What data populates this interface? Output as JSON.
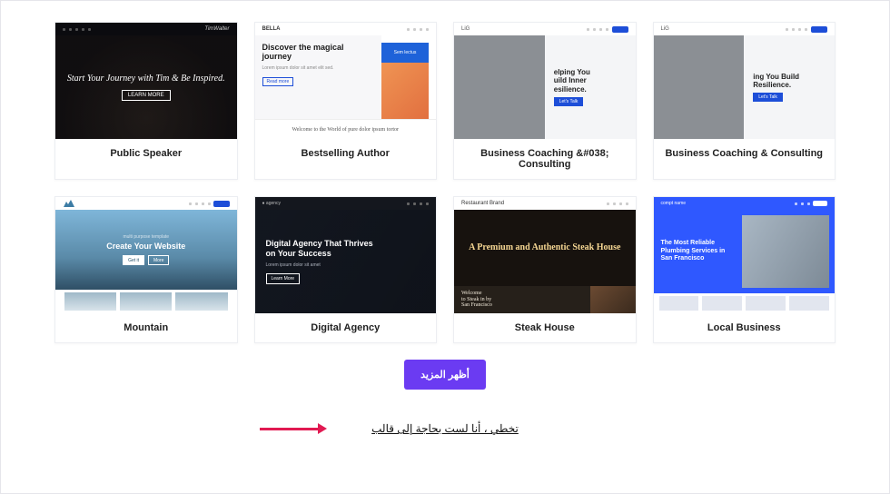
{
  "templates": [
    {
      "label": "Public Speaker",
      "hero": "Start Your Journey with Tim & Be Inspired."
    },
    {
      "label": "Bestselling Author",
      "hero": "Discover the magical journey",
      "tag": "Sem lectus",
      "footer": "Welcome to the World of pure dolor ipsum tortor"
    },
    {
      "label": "Business Coaching &#038; Consulting",
      "hero": "elping You\nuild Inner\nesilience."
    },
    {
      "label": "Business Coaching & Consulting",
      "hero": "ing You Build\nResilience."
    },
    {
      "label": "Mountain",
      "sub": "multi purpose template",
      "hero": "Create Your Website"
    },
    {
      "label": "Digital Agency",
      "hero": "Digital Agency That Thrives on Your Success"
    },
    {
      "label": "Steak House",
      "brand": "Restaurant Brand",
      "hero": "A Premium and Authentic Steak House",
      "sub": "Welcome\nto Steak in by",
      "sub2": "San Francisco"
    },
    {
      "label": "Local Business",
      "brand": "compt name",
      "hero": "The Most Reliable Plumbing Services in San Francisco"
    }
  ],
  "actions": {
    "show_more": "أظهر المزيد",
    "skip": "تخطي ، أنا لست بحاجة إلى قالب"
  },
  "colors": {
    "accent": "#6b3bf2",
    "arrow": "#e11a52"
  }
}
